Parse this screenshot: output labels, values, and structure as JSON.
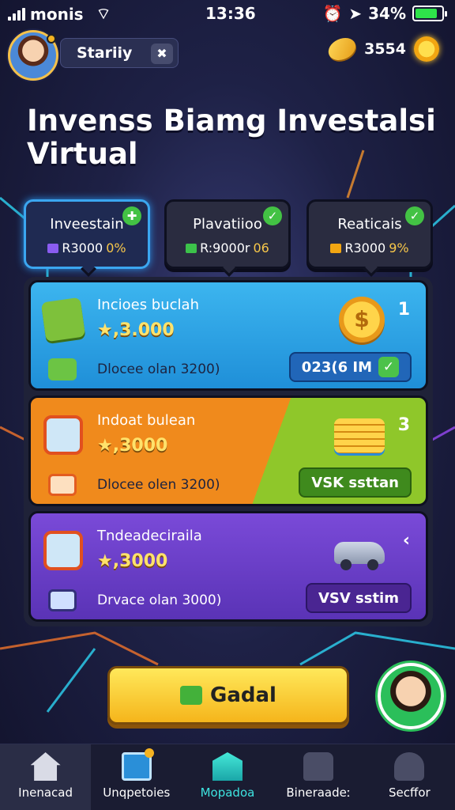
{
  "status": {
    "carrier": "monis",
    "time": "13:36",
    "battery": "34%",
    "battery_level": 0.85
  },
  "header": {
    "username": "Stariiy",
    "coins": "3554",
    "close_glyph": "✖"
  },
  "title": "Invenss Biamg Investalsi Virtual",
  "tabs": [
    {
      "label": "Inveestain",
      "value": "R3000",
      "pct": "0%",
      "active": true,
      "check": "✚"
    },
    {
      "label": "Plavatiioo",
      "value": "R:9000r",
      "pct": "06",
      "active": false,
      "check": "✓"
    },
    {
      "label": "Reaticais",
      "value": "R3000",
      "pct": "9%",
      "active": false,
      "check": "✓"
    }
  ],
  "cards": [
    {
      "name": "Incioes buclah",
      "rating": "★,3.000",
      "desc": "Dlocee olan 3200)",
      "rank": "1",
      "action": "023(6 IM",
      "action_check": "✓",
      "coin_glyph": "$",
      "color": "#2a9fe3"
    },
    {
      "name": "Indoat bulean",
      "rating": "★,3000",
      "desc": "Dlocee olen 3200)",
      "rank": "3",
      "action": "VSK ssttan",
      "color": "#f08a1c"
    },
    {
      "name": "Tndeadeciraila",
      "rating": "★,3000",
      "desc": "Drvace olan 3000)",
      "rank": "‹",
      "action": "VSV sstim",
      "color": "#6b3fcf"
    }
  ],
  "cta": {
    "label": "Gadal"
  },
  "nav": [
    {
      "label": "Inenacad",
      "icon": "home-icon",
      "active": true
    },
    {
      "label": "Unqpetoies",
      "icon": "mail-icon",
      "active": false
    },
    {
      "label": "Mopadoa",
      "icon": "hub-icon",
      "active": false
    },
    {
      "label": "Bineraadeː",
      "icon": "lock-icon",
      "active": false
    },
    {
      "label": "Secffor",
      "icon": "user-icon",
      "active": false
    }
  ],
  "colors": {
    "accent": "#f5b51b",
    "bg": "#1e2146",
    "active_tab": "#3ba6f0"
  }
}
